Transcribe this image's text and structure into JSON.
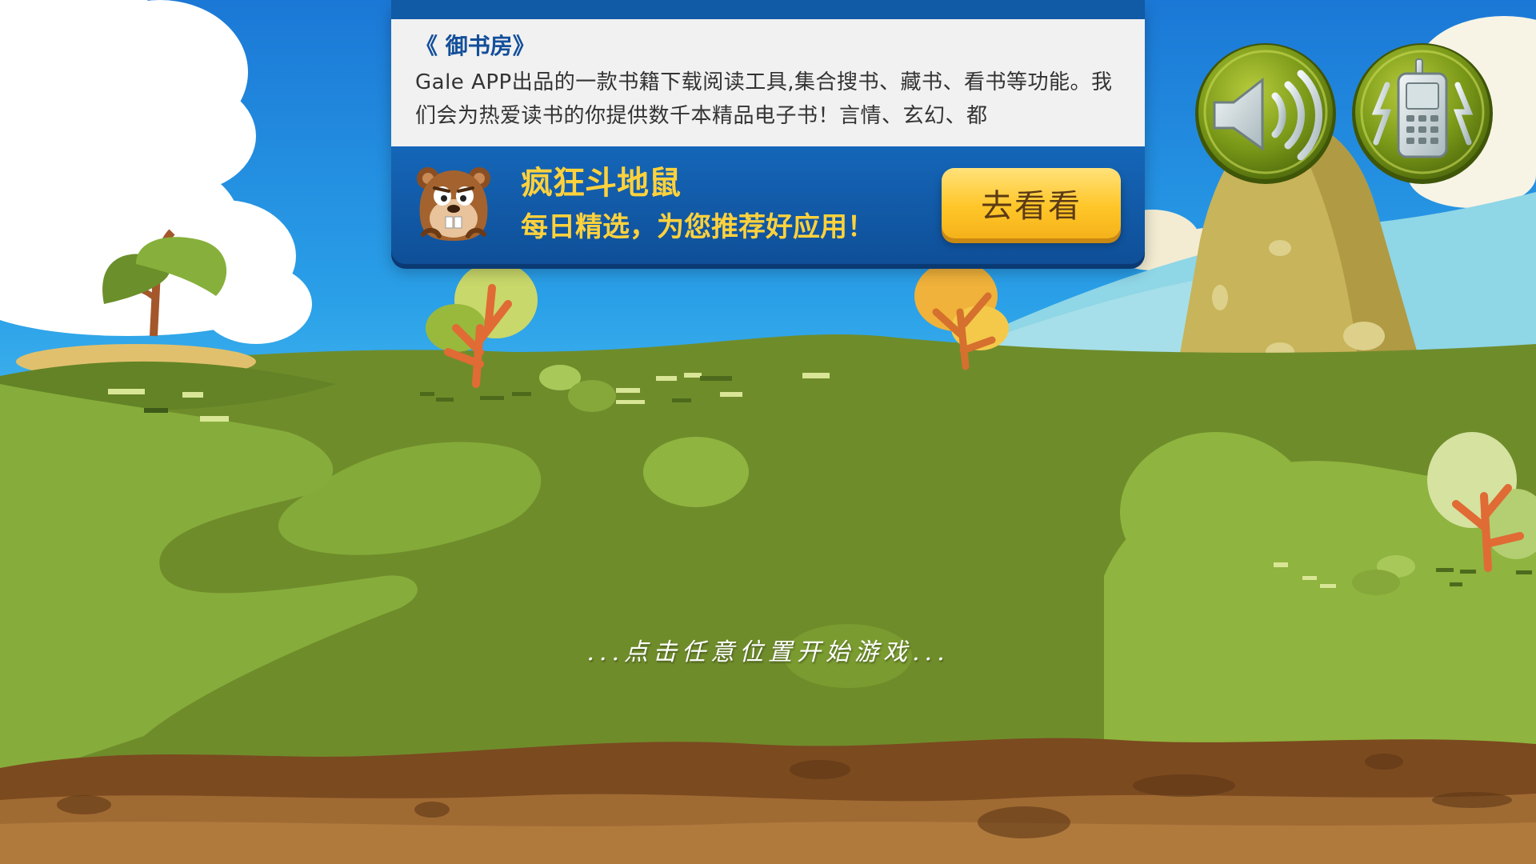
{
  "ad": {
    "book_title": "《 御书房》",
    "book_description": "Gale APP出品的一款书籍下载阅读工具,集合搜书、藏书、看书等功能。我们会为热爱读书的你提供数千本精品电子书！言情、玄幻、都",
    "app_name": "疯狂斗地鼠",
    "app_slogan": "每日精选，为您推荐好应用！",
    "cta_label": "去看看",
    "mascot_icon": "gopher-mascot-icon"
  },
  "controls": {
    "sound_icon": "speaker-icon",
    "vibrate_icon": "vibrating-phone-icon"
  },
  "game": {
    "start_hint": "...点击任意位置开始游戏..."
  },
  "colors": {
    "sky": "#2aa0e8",
    "grass": "#6f8f2a",
    "grass_light": "#8db43c",
    "dirt": "#8a5a2b",
    "ad_blue": "#1456a3",
    "ad_yellow": "#ffd23c",
    "button_green": "#6b8a12"
  }
}
